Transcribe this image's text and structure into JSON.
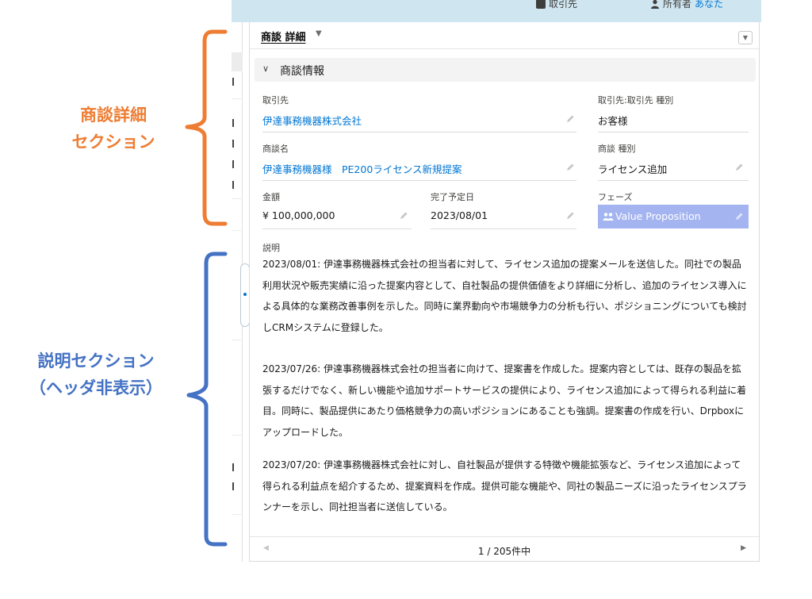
{
  "top_header": {
    "field1_label": "取引先",
    "field2_label": "所有者",
    "field2_value": "あなた"
  },
  "card": {
    "title": "商談 詳細",
    "title_caret": "▼",
    "menu_glyph": "▼",
    "section_chevron": "∨",
    "section_title": "商談情報",
    "fields": {
      "account_label": "取引先",
      "account_value": "伊達事務機器株式会社",
      "account_type_label": "取引先:取引先 種別",
      "account_type_value": "お客様",
      "opportunity_name_label": "商談名",
      "opportunity_name_value": "伊達事務機器様　PE200ライセンス新規提案",
      "opportunity_type_label": "商談 種別",
      "opportunity_type_value": "ライセンス追加",
      "amount_label": "金額",
      "amount_value": "¥ 100,000,000",
      "close_date_label": "完了予定日",
      "close_date_value": "2023/08/01",
      "phase_label": "フェーズ",
      "phase_value": "Value Proposition"
    },
    "description_label": "説明",
    "description_paragraphs": [
      "2023/08/01: 伊達事務機器株式会社の担当者に対して、ライセンス追加の提案メールを送信した。同社での製品利用状況や販売実績に沿った提案内容として、自社製品の提供価値をより詳細に分析し、追加のライセンス導入による具体的な業務改善事例を示した。同時に業界動向や市場競争力の分析も行い、ポジショニングについても検討しCRMシステムに登録した。",
      "2023/07/26: 伊達事務機器株式会社の担当者に向けて、提案書を作成した。提案内容としては、既存の製品を拡張するだけでなく、新しい機能や追加サポートサービスの提供により、ライセンス追加によって得られる利益に着目。同時に、製品提供にあたり価格競争力の高いポジションにあることも強調。提案書の作成を行い、Drpboxにアップロードした。",
      "2023/07/20: 伊達事務機器株式会社に対し、自社製品が提供する特徴や機能拡張など、ライセンス追加によって得られる利益点を紹介するため、提案資料を作成。提供可能な機能や、同社の製品ニーズに沿ったライセンスプランナーを示し、同社担当者に送信している。"
    ],
    "pager": {
      "text": "1 / 205件中",
      "prev_glyph": "◀",
      "next_glyph": "▶"
    }
  },
  "annotations": {
    "orange_line1": "商談詳細",
    "orange_line2": "セクション",
    "blue_line1": "説明セクション",
    "blue_line2": "（ヘッダ非表示）"
  },
  "colors": {
    "orange": "#ee7d33",
    "blue": "#4472c4",
    "link": "#0176d3",
    "phase_bg": "#a4b4f0",
    "header_strip": "#cfe6f1"
  }
}
